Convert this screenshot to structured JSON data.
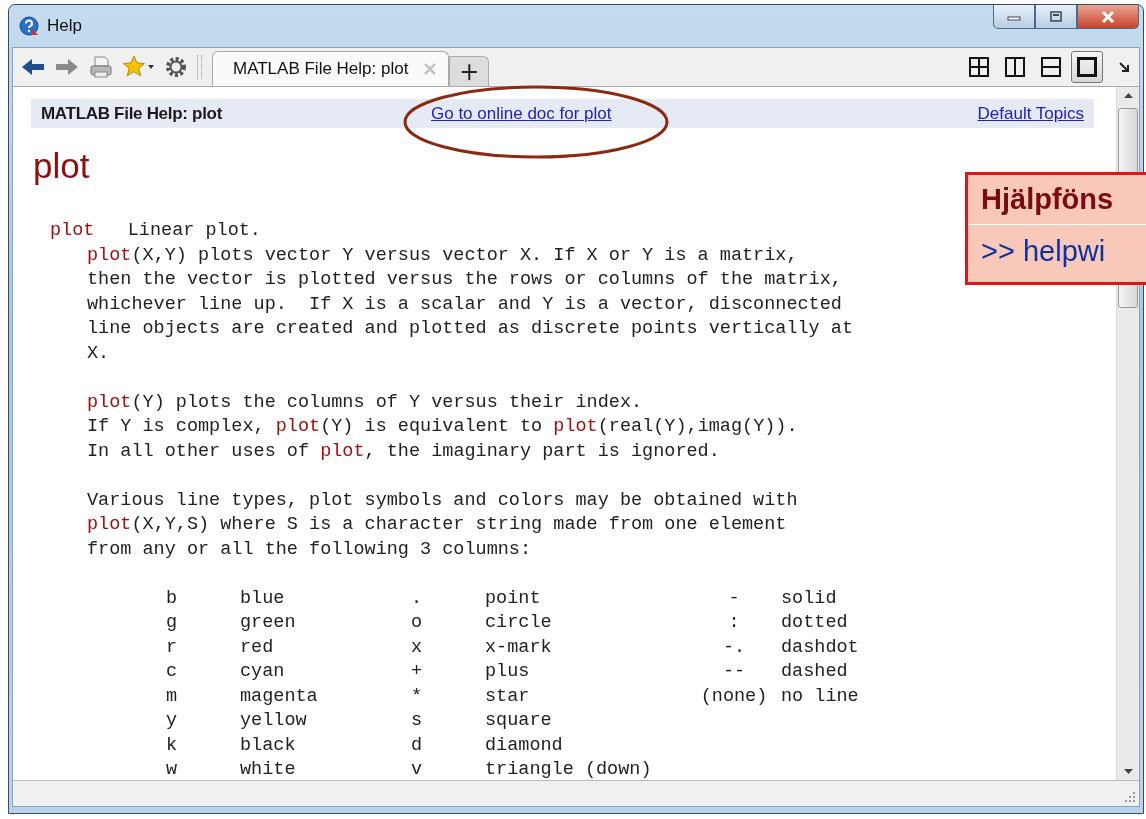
{
  "window": {
    "title": "Help"
  },
  "toolbar": {
    "tabs": [
      {
        "label": "MATLAB File Help: plot",
        "selected": true
      }
    ],
    "new_tab": "+",
    "layouts": [
      {
        "kind": "grid",
        "selected": false
      },
      {
        "kind": "columns",
        "selected": false
      },
      {
        "kind": "rows",
        "selected": false
      },
      {
        "kind": "single",
        "selected": true
      }
    ]
  },
  "header": {
    "title": "MATLAB File Help: plot",
    "online_link": "Go to online doc for plot",
    "topics_link": "Default Topics"
  },
  "page": {
    "heading": "plot",
    "synopsis": [
      {
        "kind": "link",
        "text": "plot"
      },
      {
        "kind": "text",
        "text": "   Linear plot."
      }
    ],
    "paragraphs": [
      [
        [
          {
            "kind": "link",
            "text": "plot"
          },
          {
            "kind": "text",
            "text": "(X,Y) plots vector Y versus vector X. If X or Y is a matrix,"
          }
        ],
        [
          {
            "kind": "text",
            "text": "then the vector is plotted versus the rows or columns of the matrix,"
          }
        ],
        [
          {
            "kind": "text",
            "text": "whichever line up.  If X is a scalar and Y is a vector, disconnected"
          }
        ],
        [
          {
            "kind": "text",
            "text": "line objects are created and plotted as discrete points vertically at"
          }
        ],
        [
          {
            "kind": "text",
            "text": "X."
          }
        ]
      ],
      [
        [
          {
            "kind": "link",
            "text": "plot"
          },
          {
            "kind": "text",
            "text": "(Y) plots the columns of Y versus their index."
          }
        ],
        [
          {
            "kind": "text",
            "text": "If Y is complex, "
          },
          {
            "kind": "link",
            "text": "plot"
          },
          {
            "kind": "text",
            "text": "(Y) is equivalent to "
          },
          {
            "kind": "link",
            "text": "plot"
          },
          {
            "kind": "text",
            "text": "(real(Y),imag(Y))."
          }
        ],
        [
          {
            "kind": "text",
            "text": "In all other uses of "
          },
          {
            "kind": "link",
            "text": "plot"
          },
          {
            "kind": "text",
            "text": ", the imaginary part is ignored."
          }
        ]
      ],
      [
        [
          {
            "kind": "text",
            "text": "Various line types, plot symbols and colors may be obtained with"
          }
        ],
        [
          {
            "kind": "link",
            "text": "plot"
          },
          {
            "kind": "text",
            "text": "(X,Y,S) where S is a character string made from one element"
          }
        ],
        [
          {
            "kind": "text",
            "text": "from any or all the following 3 columns:"
          }
        ]
      ]
    ],
    "table": {
      "rows": [
        [
          "b",
          "blue",
          ".",
          "point",
          "-",
          "solid"
        ],
        [
          "g",
          "green",
          "o",
          "circle",
          ":",
          "dotted"
        ],
        [
          "r",
          "red",
          "x",
          "x-mark",
          "-.",
          "dashdot"
        ],
        [
          "c",
          "cyan",
          "+",
          "plus",
          "--",
          "dashed"
        ],
        [
          "m",
          "magenta",
          "*",
          "star",
          "(none)",
          "no line"
        ],
        [
          "y",
          "yellow",
          "s",
          "square"
        ],
        [
          "k",
          "black",
          "d",
          "diamond"
        ],
        [
          "w",
          "white",
          "v",
          "triangle (down)"
        ]
      ]
    }
  },
  "callout": {
    "title": "Hjälpföns",
    "command": ">> helpwi"
  }
}
